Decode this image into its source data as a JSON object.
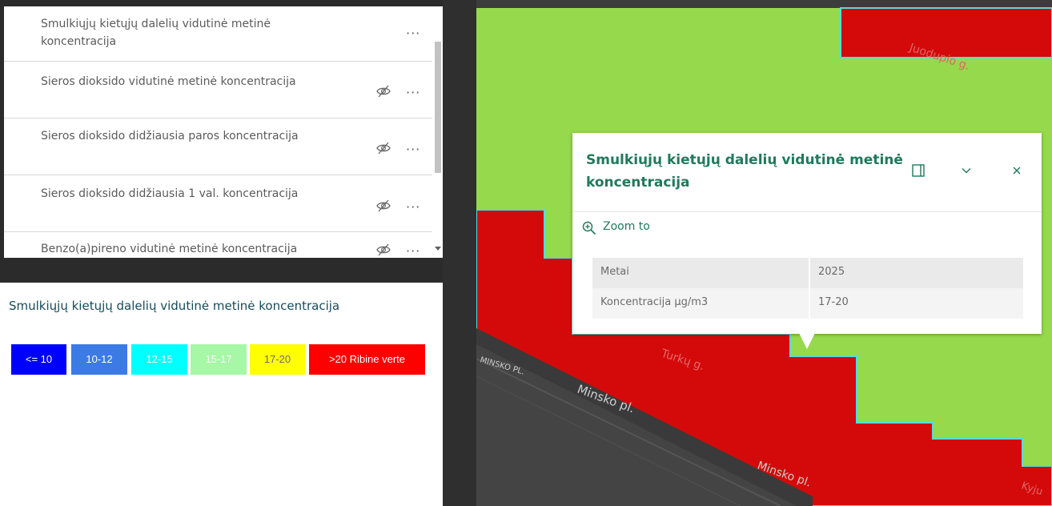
{
  "layer_list": {
    "items": [
      {
        "label": "Smulkiųjų kietųjų dalelių vidutinė metinė koncentracija",
        "visible": true
      },
      {
        "label": "Sieros dioksido vidutinė metinė koncentracija",
        "visible": false
      },
      {
        "label": "Sieros dioksido didžiausia paros koncentracija",
        "visible": false
      },
      {
        "label": "Sieros dioksido didžiausia 1 val. koncentracija",
        "visible": false
      },
      {
        "label": "Benzo(a)pireno vidutinė metinė koncentracija",
        "visible": false
      }
    ],
    "more_glyph": "···"
  },
  "legend": {
    "title": "Smulkiųjų kietųjų dalelių vidutinė metinė koncentracija",
    "classes": [
      {
        "label": "<= 10",
        "color": "#0000ff",
        "text_color": "#ffffff"
      },
      {
        "label": "10-12",
        "color": "#3c7ae6",
        "text_color": "#ffffff"
      },
      {
        "label": "12-15",
        "color": "#00ffff",
        "text_color": "#ffffff"
      },
      {
        "label": "15-17",
        "color": "#a6f7a6",
        "text_color": "#ffffff"
      },
      {
        "label": "17-20",
        "color": "#ffff00",
        "text_color": "#6b6b6b"
      },
      {
        "label": ">20 Ribine verte",
        "color": "#ff0000",
        "text_color": "#ffffff"
      }
    ]
  },
  "map": {
    "colors": {
      "green_zone": "#96d94c",
      "red_zone": "#d40a0a",
      "boundary": "#4ce0d8",
      "basemap": "#3c3c3c"
    },
    "street_labels": [
      "Juodupio g.",
      "Turkų g.",
      "MINSKO PL.",
      "Minsko pl.",
      "Minsko pl.",
      "Kyju"
    ]
  },
  "popup": {
    "title": "Smulkiųjų kietųjų dalelių vidutinė metinė koncentracija",
    "zoom_to_label": "Zoom to",
    "attributes": [
      {
        "key": "Metai",
        "value": "2025"
      },
      {
        "key": "Koncentracija µg/m3",
        "value": "17-20"
      }
    ],
    "accent_color": "#1f7a5c"
  }
}
